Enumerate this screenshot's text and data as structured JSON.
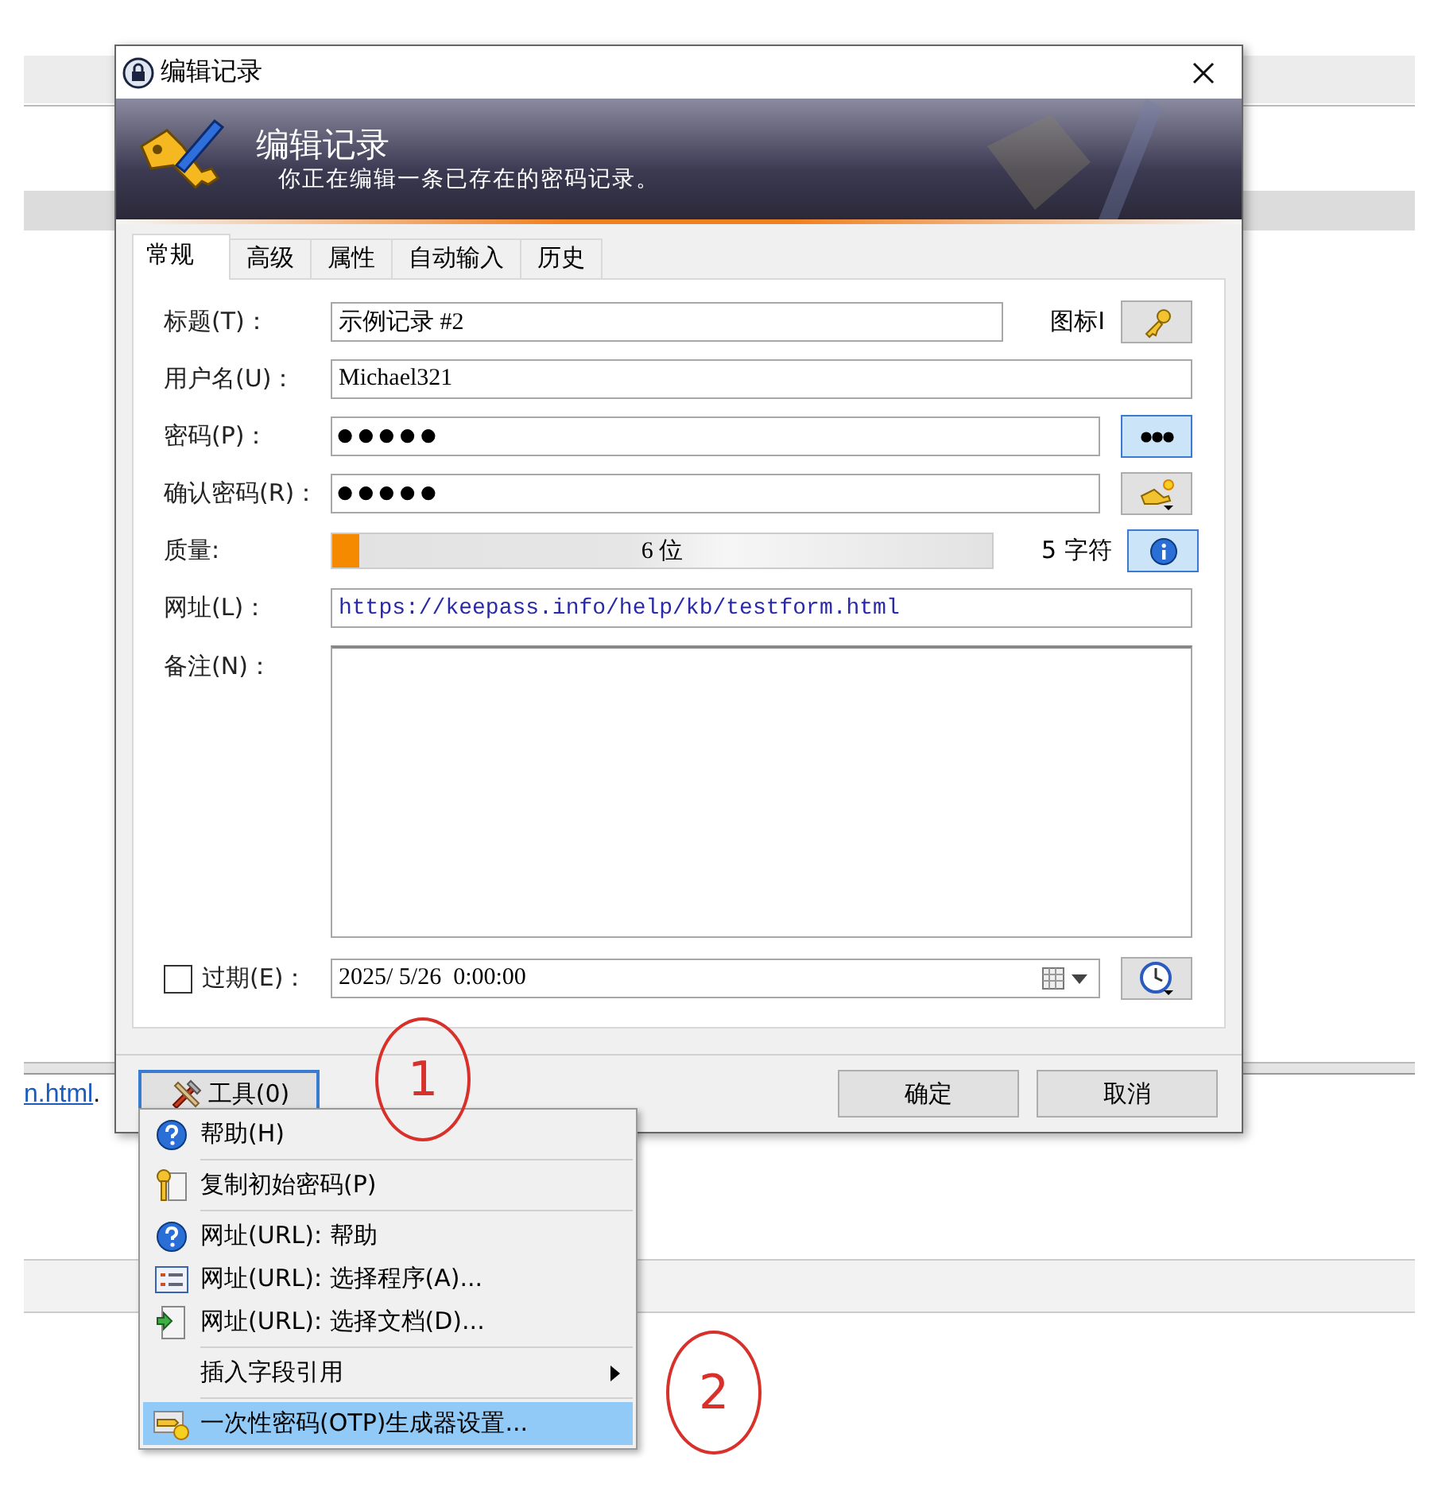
{
  "background_page": {
    "link": "n.html",
    "trailing": "."
  },
  "window": {
    "title": "编辑记录"
  },
  "banner": {
    "title": "编辑记录",
    "subtitle": "你正在编辑一条已存在的密码记录。"
  },
  "tabs": [
    {
      "label": "常规",
      "selected": true
    },
    {
      "label": "高级",
      "selected": false
    },
    {
      "label": "属性",
      "selected": false
    },
    {
      "label": "自动输入",
      "selected": false
    },
    {
      "label": "历史",
      "selected": false
    }
  ],
  "fields": [
    {
      "kind": "text",
      "label": "标题(T)：",
      "value": "示例记录 #2",
      "side_label": "图标I",
      "button": true
    },
    {
      "kind": "text",
      "label": "用户名(U)：",
      "value": "Michael321"
    },
    {
      "kind": "password",
      "label": "密码(P)：",
      "value": "●●●●●",
      "button": true
    },
    {
      "kind": "password",
      "label": "确认密码(R)：",
      "value": "●●●●●",
      "button": true
    },
    {
      "kind": "quality",
      "label": "质量:",
      "level": 0.04,
      "reading": "6 位",
      "side_label": "5 字符",
      "button": true
    },
    {
      "kind": "url",
      "label": "网址(L)：",
      "value": "https://keepass.info/help/kb/testform.html"
    },
    {
      "kind": "notes",
      "label": "备注(N)："
    }
  ],
  "expiry": {
    "label": "过期(E)：",
    "checked": false,
    "value": "2025/ 5/26  0:00:00"
  },
  "buttons": {
    "tools": "工具(0)",
    "ok": "确定",
    "cancel": "取消"
  },
  "menu": [
    {
      "kind": "item",
      "label": "帮助(H)",
      "submenu": false,
      "selected": false
    },
    {
      "kind": "separator"
    },
    {
      "kind": "item",
      "label": "复制初始密码(P)",
      "submenu": false,
      "selected": false
    },
    {
      "kind": "separator"
    },
    {
      "kind": "item",
      "label": "网址(URL): 帮助",
      "submenu": false,
      "selected": false
    },
    {
      "kind": "item",
      "label": "网址(URL): 选择程序(A)...",
      "submenu": false,
      "selected": false
    },
    {
      "kind": "item",
      "label": "网址(URL): 选择文档(D)...",
      "submenu": false,
      "selected": false
    },
    {
      "kind": "separator"
    },
    {
      "kind": "item",
      "label": "插入字段引用",
      "submenu": true,
      "selected": false
    },
    {
      "kind": "separator"
    },
    {
      "kind": "item",
      "label": "一次性密码(OTP)生成器设置...",
      "submenu": false,
      "selected": true
    }
  ],
  "annotations": [
    {
      "label": "1"
    },
    {
      "label": "2"
    }
  ]
}
